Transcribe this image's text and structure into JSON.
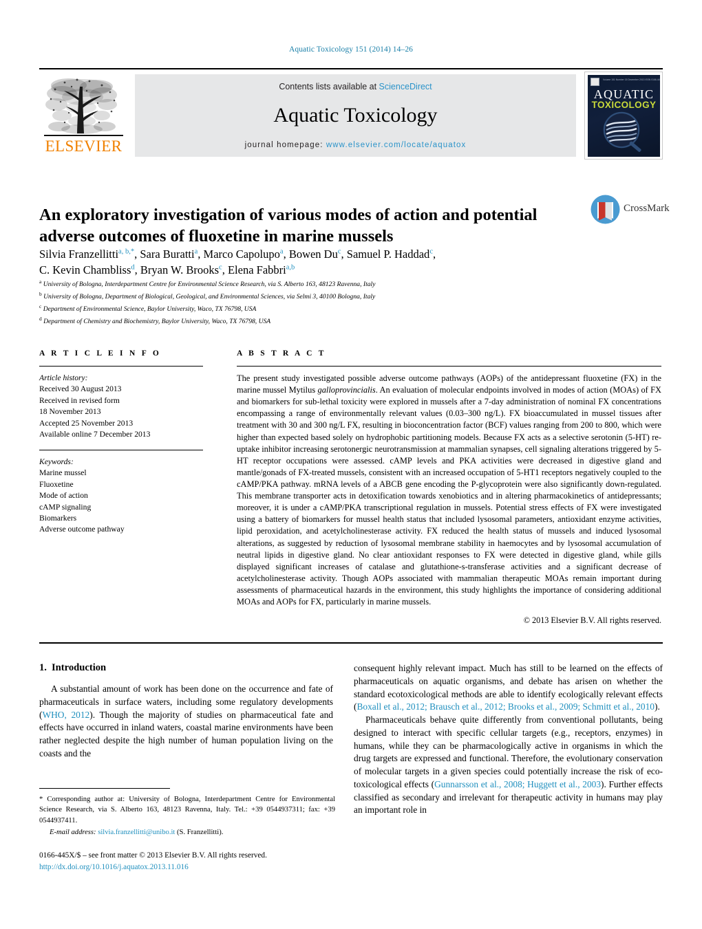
{
  "running_head": "Aquatic Toxicology 151 (2014) 14–26",
  "masthead": {
    "contents_prefix": "Contents lists available at ",
    "sciencedirect": "ScienceDirect",
    "journal_title": "Aquatic Toxicology",
    "homepage_label": "journal homepage:",
    "homepage_url": "www.elsevier.com/locate/aquatox",
    "publisher": "ELSEVIER",
    "accent_orange": "#F08000",
    "link_blue": "#2a93c9"
  },
  "cover": {
    "top_text": "Volume 151 Number 15 December 2013    ISSN 0166-445X",
    "line1": "AQUATIC",
    "line2": "TOXICOLOGY",
    "bg_color": "#0d1b33",
    "line2_color": "#c8d93a"
  },
  "article": {
    "title": "An exploratory investigation of various modes of action and potential adverse outcomes of fluoxetine in marine mussels",
    "crossmark_label": "CrossMark",
    "authors": [
      {
        "name": "Silvia Franzellitti",
        "marks": "a,b,",
        "star": true
      },
      {
        "name": "Sara Buratti",
        "marks": "a"
      },
      {
        "name": "Marco Capolupo",
        "marks": "a"
      },
      {
        "name": "Bowen Du",
        "marks": "c"
      },
      {
        "name": "Samuel P. Haddad",
        "marks": "c"
      },
      {
        "name": "C. Kevin Chambliss",
        "marks": "d"
      },
      {
        "name": "Bryan W. Brooks",
        "marks": "c"
      },
      {
        "name": "Elena Fabbri",
        "marks": "a,b"
      }
    ],
    "affiliations": [
      {
        "mark": "a",
        "text": "University of Bologna, Interdepartment Centre for Environmental Science Research, via S. Alberto 163, 48123 Ravenna, Italy"
      },
      {
        "mark": "b",
        "text": "University of Bologna, Department of Biological, Geological, and Environmental Sciences, via Selmi 3, 40100 Bologna, Italy"
      },
      {
        "mark": "c",
        "text": "Department of Environmental Science, Baylor University, Waco, TX 76798, USA"
      },
      {
        "mark": "d",
        "text": "Department of Chemistry and Biochemistry, Baylor University, Waco, TX 76798, USA"
      }
    ]
  },
  "article_info": {
    "heading": "A R T I C L E    I N F O",
    "history_label": "Article history:",
    "history": [
      "Received 30 August 2013",
      "Received in revised form",
      "18 November 2013",
      "Accepted 25 November 2013",
      "Available online 7 December 2013"
    ],
    "keywords_label": "Keywords:",
    "keywords": [
      "Marine mussel",
      "Fluoxetine",
      "Mode of action",
      "cAMP signaling",
      "Biomarkers",
      "Adverse outcome pathway"
    ]
  },
  "abstract": {
    "heading": "A B S T R A C T",
    "part1": "The present study investigated possible adverse outcome pathways (AOPs) of the antidepressant fluoxetine (FX) in the marine mussel Mytilus ",
    "species": "galloprovincialis",
    "part2": ". An evaluation of molecular endpoints involved in modes of action (MOAs) of FX and biomarkers for sub-lethal toxicity were explored in mussels after a 7-day administration of nominal FX concentrations encompassing a range of environmentally relevant values (0.03–300 ng/L). FX bioaccumulated in mussel tissues after treatment with 30 and 300 ng/L FX, resulting in bioconcentration factor (BCF) values ranging from 200 to 800, which were higher than expected based solely on hydrophobic partitioning models. Because FX acts as a selective serotonin (5-HT) re-uptake inhibitor increasing serotonergic neurotransmission at mammalian synapses, cell signaling alterations triggered by 5-HT receptor occupations were assessed. cAMP levels and PKA activities were decreased in digestive gland and mantle/gonads of FX-treated mussels, consistent with an increased occupation of 5-HT1 receptors negatively coupled to the cAMP/PKA pathway. mRNA levels of a ABCB gene encoding the P-glycoprotein were also significantly down-regulated. This membrane transporter acts in detoxification towards xenobiotics and in altering pharmacokinetics of antidepressants; moreover, it is under a cAMP/PKA transcriptional regulation in mussels. Potential stress effects of FX were investigated using a battery of biomarkers for mussel health status that included lysosomal parameters, antioxidant enzyme activities, lipid peroxidation, and acetylcholinesterase activity. FX reduced the health status of mussels and induced lysosomal alterations, as suggested by reduction of lysosomal membrane stability in haemocytes and by lysosomal accumulation of neutral lipids in digestive gland. No clear antioxidant responses to FX were detected in digestive gland, while gills displayed significant increases of catalase and glutathione-s-transferase activities and a significant decrease of acetylcholinesterase activity. Though AOPs associated with mammalian therapeutic MOAs remain important during assessments of pharmaceutical hazards in the environment, this study highlights the importance of considering additional MOAs and AOPs for FX, particularly in marine mussels.",
    "copyright": "© 2013 Elsevier B.V. All rights reserved."
  },
  "introduction": {
    "number": "1.",
    "heading": "Introduction",
    "left_p1_a": "A substantial amount of work has been done on the occurrence and fate of pharmaceuticals in surface waters, including some regulatory developments (",
    "left_p1_ref": "WHO, 2012",
    "left_p1_b": "). Though the majority of studies on pharmaceutical fate and effects have occurred in inland waters, coastal marine environments have been rather neglected despite the high number of human population living on the coasts and the",
    "right_p1_a": "consequent highly relevant impact. Much has still to be learned on the effects of pharmaceuticals on aquatic organisms, and debate has arisen on whether the standard ecotoxicological methods are able to identify ecologically relevant effects (",
    "right_p1_ref": "Boxall et al., 2012; Brausch et al., 2012; Brooks et al., 2009; Schmitt et al., 2010",
    "right_p1_b": ").",
    "right_p2_a": "Pharmaceuticals behave quite differently from conventional pollutants, being designed to interact with specific cellular targets (e.g., receptors, enzymes) in humans, while they can be pharmacologically active in organisms in which the drug targets are expressed and functional. Therefore, the evolutionary conservation of molecular targets in a given species could potentially increase the risk of eco-toxicological effects (",
    "right_p2_ref": "Gunnarsson et al., 2008; Huggett et al., 2003",
    "right_p2_b": "). Further effects classified as secondary and irrelevant for therapeutic activity in humans may play an important role in"
  },
  "footer": {
    "corresponding_star": "*",
    "corresponding": "Corresponding author at: University of Bologna, Interdepartment Centre for Environmental Science Research, via S. Alberto 163, 48123 Ravenna, Italy. Tel.: +39 0544937311; fax: +39 0544937411.",
    "email_label": "E-mail address:",
    "email": "silvia.franzellitti@unibo.it",
    "email_owner": "(S. Franzellitti).",
    "issn_line": "0166-445X/$ – see front matter © 2013 Elsevier B.V. All rights reserved.",
    "doi": "http://dx.doi.org/10.1016/j.aquatox.2013.11.016"
  }
}
